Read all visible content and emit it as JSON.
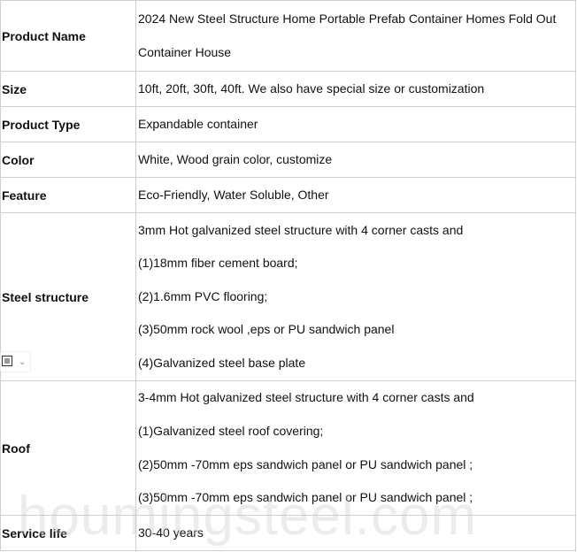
{
  "rows": [
    {
      "key": "Product Name",
      "lines": [
        "2024 New Steel Structure Home Portable Prefab Container Homes Fold Out",
        "Container House"
      ]
    },
    {
      "key": "Size",
      "lines": [
        "10ft, 20ft,   30ft, 40ft.   We also  have special size or customization"
      ]
    },
    {
      "key": "Product Type",
      "lines": [
        "Expandable container"
      ]
    },
    {
      "key": "Color",
      "lines": [
        "White, Wood grain color, customize"
      ]
    },
    {
      "key": "Feature",
      "lines": [
        "Eco-Friendly, Water Soluble, Other"
      ]
    },
    {
      "key": "Steel structure",
      "lines": [
        "3mm Hot galvanized steel structure with 4 corner casts and",
        "(1)18mm fiber cement board;",
        "(2)1.6mm PVC flooring;",
        "(3)50mm rock wool ,eps or PU sandwich panel",
        "(4)Galvanized steel base plate"
      ]
    },
    {
      "key": "Roof",
      "lines": [
        "3-4mm Hot galvanized steel structure with 4 corner casts and",
        "(1)Galvanized steel roof covering;",
        "(2)50mm -70mm eps sandwich panel or PU sandwich panel ;",
        "(3)50mm -70mm eps sandwich panel or PU sandwich panel ;"
      ]
    },
    {
      "key": "Service life",
      "lines": [
        "30-40 years"
      ]
    }
  ],
  "watermark": "houmingsteel.com",
  "icons": {
    "layout_control": "paragraph-layout-icon",
    "dropdown": "chevron-down-icon"
  }
}
